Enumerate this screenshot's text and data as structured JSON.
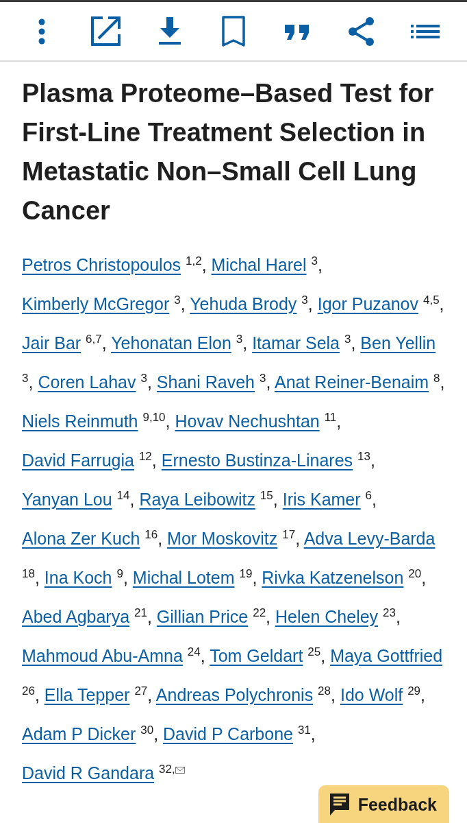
{
  "toolbar": {
    "buttons": [
      {
        "kind": "more"
      },
      {
        "kind": "open"
      },
      {
        "kind": "download"
      },
      {
        "kind": "bookmark"
      },
      {
        "kind": "cite"
      },
      {
        "kind": "share"
      },
      {
        "kind": "outline"
      }
    ]
  },
  "article": {
    "title": "Plasma Proteome–Based Test for First-Line Treatment Selection in Metastatic Non–Small Cell Lung Cancer",
    "authors": [
      {
        "name": "Petros Christopoulos",
        "affiliations": "1,2",
        "separator": ","
      },
      {
        "name": "Michal Harel",
        "affiliations": "3",
        "separator": ","
      },
      {
        "name": "Kimberly McGregor",
        "affiliations": "3",
        "separator": ","
      },
      {
        "name": "Yehuda Brody",
        "affiliations": "3",
        "separator": ","
      },
      {
        "name": "Igor Puzanov",
        "affiliations": "4,5",
        "separator": ","
      },
      {
        "name": "Jair Bar",
        "affiliations": "6,7",
        "separator": ","
      },
      {
        "name": "Yehonatan Elon",
        "affiliations": "3",
        "separator": ","
      },
      {
        "name": "Itamar Sela",
        "affiliations": "3",
        "separator": ","
      },
      {
        "name": "Ben Yellin",
        "affiliations": "3",
        "separator": ","
      },
      {
        "name": "Coren Lahav",
        "affiliations": "3",
        "separator": ","
      },
      {
        "name": "Shani Raveh",
        "affiliations": "3",
        "separator": ","
      },
      {
        "name": "Anat Reiner-Benaim",
        "affiliations": "8",
        "separator": ","
      },
      {
        "name": "Niels Reinmuth",
        "affiliations": "9,10",
        "separator": ","
      },
      {
        "name": "Hovav Nechushtan",
        "affiliations": "11",
        "separator": ","
      },
      {
        "name": "David Farrugia",
        "affiliations": "12",
        "separator": ","
      },
      {
        "name": "Ernesto Bustinza-Linares",
        "affiliations": "13",
        "separator": ","
      },
      {
        "name": "Yanyan Lou",
        "affiliations": "14",
        "separator": ","
      },
      {
        "name": "Raya Leibowitz",
        "affiliations": "15",
        "separator": ","
      },
      {
        "name": "Iris Kamer",
        "affiliations": "6",
        "separator": ","
      },
      {
        "name": "Alona Zer Kuch",
        "affiliations": "16",
        "separator": ","
      },
      {
        "name": "Mor Moskovitz",
        "affiliations": "17",
        "separator": ","
      },
      {
        "name": "Adva Levy-Barda",
        "affiliations": "18",
        "separator": ","
      },
      {
        "name": "Ina Koch",
        "affiliations": "9",
        "separator": ","
      },
      {
        "name": "Michal Lotem",
        "affiliations": "19",
        "separator": ","
      },
      {
        "name": "Rivka Katzenelson",
        "affiliations": "20",
        "separator": ","
      },
      {
        "name": "Abed Agbarya",
        "affiliations": "21",
        "separator": ","
      },
      {
        "name": "Gillian Price",
        "affiliations": "22",
        "separator": ","
      },
      {
        "name": "Helen Cheley",
        "affiliations": "23",
        "separator": ","
      },
      {
        "name": "Mahmoud Abu-Amna",
        "affiliations": "24",
        "separator": ","
      },
      {
        "name": "Tom Geldart",
        "affiliations": "25",
        "separator": ","
      },
      {
        "name": "Maya Gottfried",
        "affiliations": "26",
        "separator": ","
      },
      {
        "name": "Ella Tepper",
        "affiliations": "27",
        "separator": ","
      },
      {
        "name": "Andreas Polychronis",
        "affiliations": "28",
        "separator": ","
      },
      {
        "name": "Ido Wolf",
        "affiliations": "29",
        "separator": ","
      },
      {
        "name": "Adam P Dicker",
        "affiliations": "30",
        "separator": ","
      },
      {
        "name": "David P Carbone",
        "affiliations": "31",
        "separator": ","
      },
      {
        "name": "David R Gandara",
        "affiliations": "32,",
        "corresponding": true
      }
    ]
  },
  "feedback_button": {
    "label": "Feedback"
  }
}
